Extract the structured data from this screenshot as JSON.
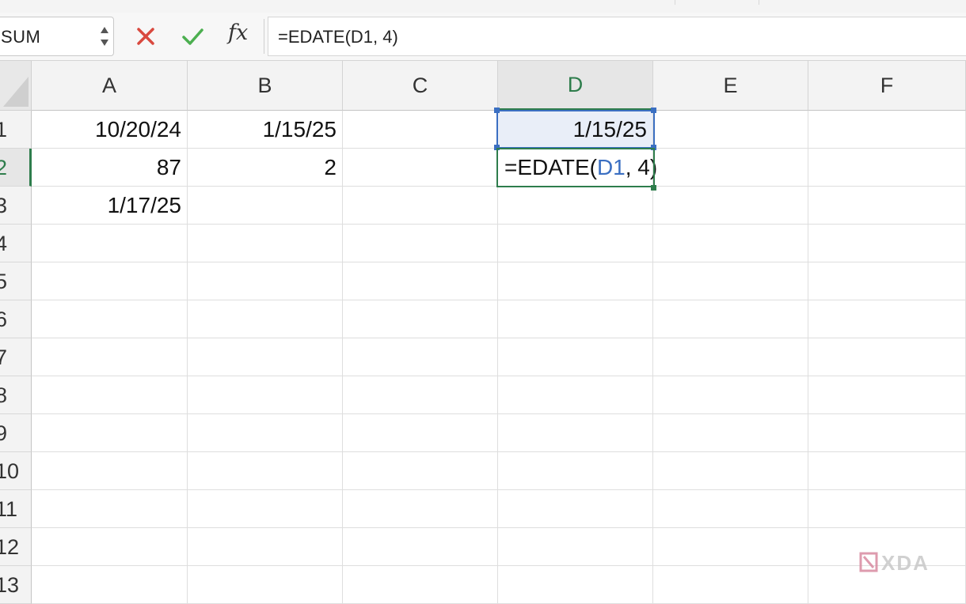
{
  "formula_bar": {
    "name_box": "SUM",
    "cancel_icon": "close-icon",
    "enter_icon": "check-icon",
    "fx_label": "fx",
    "formula": "=EDATE(D1, 4)"
  },
  "columns": [
    "A",
    "B",
    "C",
    "D",
    "E",
    "F"
  ],
  "active_column": "D",
  "rows": [
    "1",
    "2",
    "3",
    "4",
    "5",
    "6",
    "7",
    "8",
    "9",
    "10",
    "11",
    "12",
    "13"
  ],
  "active_row": "2",
  "cells": {
    "A1": "10/20/24",
    "B1": "1/15/25",
    "D1": "1/15/25",
    "A2": "87",
    "B2": "2",
    "D2_prefix": "=EDATE(",
    "D2_ref": "D1",
    "D2_suffix": ", 4)",
    "A3": "1/17/25"
  },
  "colors": {
    "accent_green": "#2e7d4c",
    "reference_blue": "#3b6fc2",
    "cancel_red": "#d9493f",
    "enter_green": "#4caf50"
  },
  "watermark": "XDA"
}
